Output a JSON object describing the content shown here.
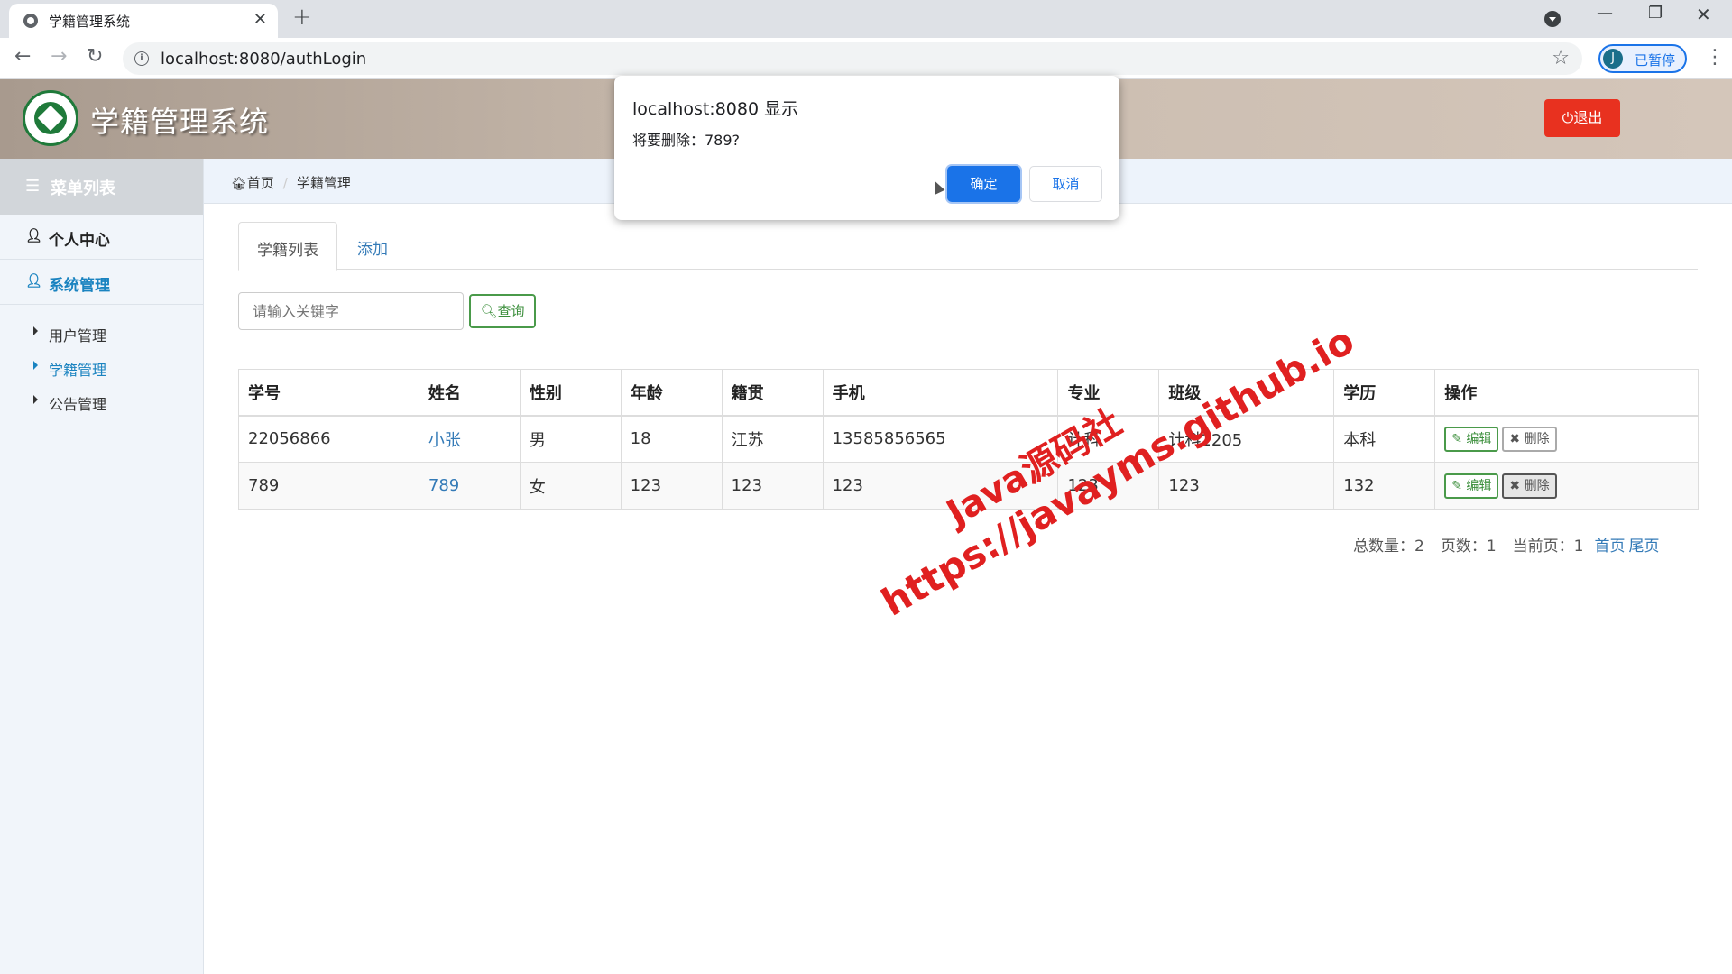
{
  "browser": {
    "tab_title": "学籍管理系统",
    "url": "localhost:8080/authLogin",
    "profile_initial": "J",
    "profile_label": "已暂停"
  },
  "header": {
    "title": "学籍管理系统",
    "logout_label": "退出"
  },
  "sidebar": {
    "heading": "菜单列表",
    "items": [
      {
        "label": "个人中心"
      },
      {
        "label": "系统管理"
      }
    ],
    "sub_items": [
      {
        "label": "用户管理"
      },
      {
        "label": "学籍管理"
      },
      {
        "label": "公告管理"
      }
    ]
  },
  "breadcrumb": {
    "home": "首页",
    "current": "学籍管理"
  },
  "tabs": {
    "list": "学籍列表",
    "add": "添加"
  },
  "search": {
    "placeholder": "请输入关键字",
    "button_label": "查询"
  },
  "table": {
    "headers": [
      "学号",
      "姓名",
      "性别",
      "年龄",
      "籍贯",
      "手机",
      "专业",
      "班级",
      "学历",
      "操作"
    ],
    "rows": [
      {
        "id": "22056866",
        "name": "小张",
        "gender": "男",
        "age": "18",
        "hometown": "江苏",
        "phone": "13585856565",
        "major": "计科",
        "class": "计科2205",
        "education": "本科"
      },
      {
        "id": "789",
        "name": "789",
        "gender": "女",
        "age": "123",
        "hometown": "123",
        "phone": "123",
        "major": "123",
        "class": "123",
        "education": "132"
      }
    ],
    "edit_label": "编辑",
    "delete_label": "删除"
  },
  "pager": {
    "total": "总数量：2",
    "pages": "页数：1",
    "current": "当前页：1",
    "first": "首页",
    "last": "尾页"
  },
  "dialog": {
    "title": "localhost:8080 显示",
    "message": "将要删除：789?",
    "ok_label": "确定",
    "cancel_label": "取消"
  },
  "watermark": {
    "line1": "Java源码社",
    "line2": "https://javayms.github.io"
  },
  "colors": {
    "accent": "#1a83c0",
    "logout": "#e8311f",
    "dialog_ok": "#1a73e8",
    "watermark": "#e02020"
  }
}
